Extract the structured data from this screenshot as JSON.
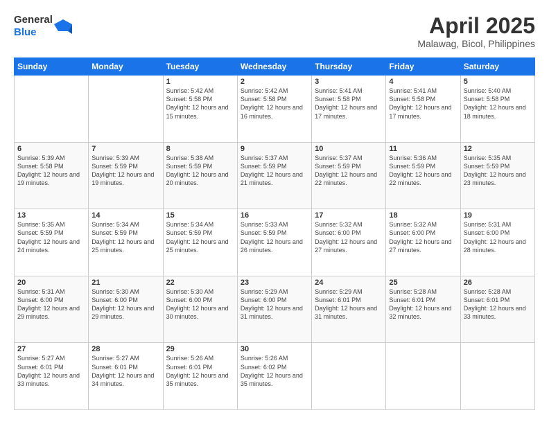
{
  "logo": {
    "line1": "General",
    "line2": "Blue"
  },
  "title": "April 2025",
  "location": "Malawag, Bicol, Philippines",
  "days_header": [
    "Sunday",
    "Monday",
    "Tuesday",
    "Wednesday",
    "Thursday",
    "Friday",
    "Saturday"
  ],
  "weeks": [
    [
      {
        "num": "",
        "sunrise": "",
        "sunset": "",
        "daylight": ""
      },
      {
        "num": "",
        "sunrise": "",
        "sunset": "",
        "daylight": ""
      },
      {
        "num": "1",
        "sunrise": "Sunrise: 5:42 AM",
        "sunset": "Sunset: 5:58 PM",
        "daylight": "Daylight: 12 hours and 15 minutes."
      },
      {
        "num": "2",
        "sunrise": "Sunrise: 5:42 AM",
        "sunset": "Sunset: 5:58 PM",
        "daylight": "Daylight: 12 hours and 16 minutes."
      },
      {
        "num": "3",
        "sunrise": "Sunrise: 5:41 AM",
        "sunset": "Sunset: 5:58 PM",
        "daylight": "Daylight: 12 hours and 17 minutes."
      },
      {
        "num": "4",
        "sunrise": "Sunrise: 5:41 AM",
        "sunset": "Sunset: 5:58 PM",
        "daylight": "Daylight: 12 hours and 17 minutes."
      },
      {
        "num": "5",
        "sunrise": "Sunrise: 5:40 AM",
        "sunset": "Sunset: 5:58 PM",
        "daylight": "Daylight: 12 hours and 18 minutes."
      }
    ],
    [
      {
        "num": "6",
        "sunrise": "Sunrise: 5:39 AM",
        "sunset": "Sunset: 5:58 PM",
        "daylight": "Daylight: 12 hours and 19 minutes."
      },
      {
        "num": "7",
        "sunrise": "Sunrise: 5:39 AM",
        "sunset": "Sunset: 5:59 PM",
        "daylight": "Daylight: 12 hours and 19 minutes."
      },
      {
        "num": "8",
        "sunrise": "Sunrise: 5:38 AM",
        "sunset": "Sunset: 5:59 PM",
        "daylight": "Daylight: 12 hours and 20 minutes."
      },
      {
        "num": "9",
        "sunrise": "Sunrise: 5:37 AM",
        "sunset": "Sunset: 5:59 PM",
        "daylight": "Daylight: 12 hours and 21 minutes."
      },
      {
        "num": "10",
        "sunrise": "Sunrise: 5:37 AM",
        "sunset": "Sunset: 5:59 PM",
        "daylight": "Daylight: 12 hours and 22 minutes."
      },
      {
        "num": "11",
        "sunrise": "Sunrise: 5:36 AM",
        "sunset": "Sunset: 5:59 PM",
        "daylight": "Daylight: 12 hours and 22 minutes."
      },
      {
        "num": "12",
        "sunrise": "Sunrise: 5:35 AM",
        "sunset": "Sunset: 5:59 PM",
        "daylight": "Daylight: 12 hours and 23 minutes."
      }
    ],
    [
      {
        "num": "13",
        "sunrise": "Sunrise: 5:35 AM",
        "sunset": "Sunset: 5:59 PM",
        "daylight": "Daylight: 12 hours and 24 minutes."
      },
      {
        "num": "14",
        "sunrise": "Sunrise: 5:34 AM",
        "sunset": "Sunset: 5:59 PM",
        "daylight": "Daylight: 12 hours and 25 minutes."
      },
      {
        "num": "15",
        "sunrise": "Sunrise: 5:34 AM",
        "sunset": "Sunset: 5:59 PM",
        "daylight": "Daylight: 12 hours and 25 minutes."
      },
      {
        "num": "16",
        "sunrise": "Sunrise: 5:33 AM",
        "sunset": "Sunset: 5:59 PM",
        "daylight": "Daylight: 12 hours and 26 minutes."
      },
      {
        "num": "17",
        "sunrise": "Sunrise: 5:32 AM",
        "sunset": "Sunset: 6:00 PM",
        "daylight": "Daylight: 12 hours and 27 minutes."
      },
      {
        "num": "18",
        "sunrise": "Sunrise: 5:32 AM",
        "sunset": "Sunset: 6:00 PM",
        "daylight": "Daylight: 12 hours and 27 minutes."
      },
      {
        "num": "19",
        "sunrise": "Sunrise: 5:31 AM",
        "sunset": "Sunset: 6:00 PM",
        "daylight": "Daylight: 12 hours and 28 minutes."
      }
    ],
    [
      {
        "num": "20",
        "sunrise": "Sunrise: 5:31 AM",
        "sunset": "Sunset: 6:00 PM",
        "daylight": "Daylight: 12 hours and 29 minutes."
      },
      {
        "num": "21",
        "sunrise": "Sunrise: 5:30 AM",
        "sunset": "Sunset: 6:00 PM",
        "daylight": "Daylight: 12 hours and 29 minutes."
      },
      {
        "num": "22",
        "sunrise": "Sunrise: 5:30 AM",
        "sunset": "Sunset: 6:00 PM",
        "daylight": "Daylight: 12 hours and 30 minutes."
      },
      {
        "num": "23",
        "sunrise": "Sunrise: 5:29 AM",
        "sunset": "Sunset: 6:00 PM",
        "daylight": "Daylight: 12 hours and 31 minutes."
      },
      {
        "num": "24",
        "sunrise": "Sunrise: 5:29 AM",
        "sunset": "Sunset: 6:01 PM",
        "daylight": "Daylight: 12 hours and 31 minutes."
      },
      {
        "num": "25",
        "sunrise": "Sunrise: 5:28 AM",
        "sunset": "Sunset: 6:01 PM",
        "daylight": "Daylight: 12 hours and 32 minutes."
      },
      {
        "num": "26",
        "sunrise": "Sunrise: 5:28 AM",
        "sunset": "Sunset: 6:01 PM",
        "daylight": "Daylight: 12 hours and 33 minutes."
      }
    ],
    [
      {
        "num": "27",
        "sunrise": "Sunrise: 5:27 AM",
        "sunset": "Sunset: 6:01 PM",
        "daylight": "Daylight: 12 hours and 33 minutes."
      },
      {
        "num": "28",
        "sunrise": "Sunrise: 5:27 AM",
        "sunset": "Sunset: 6:01 PM",
        "daylight": "Daylight: 12 hours and 34 minutes."
      },
      {
        "num": "29",
        "sunrise": "Sunrise: 5:26 AM",
        "sunset": "Sunset: 6:01 PM",
        "daylight": "Daylight: 12 hours and 35 minutes."
      },
      {
        "num": "30",
        "sunrise": "Sunrise: 5:26 AM",
        "sunset": "Sunset: 6:02 PM",
        "daylight": "Daylight: 12 hours and 35 minutes."
      },
      {
        "num": "",
        "sunrise": "",
        "sunset": "",
        "daylight": ""
      },
      {
        "num": "",
        "sunrise": "",
        "sunset": "",
        "daylight": ""
      },
      {
        "num": "",
        "sunrise": "",
        "sunset": "",
        "daylight": ""
      }
    ]
  ]
}
